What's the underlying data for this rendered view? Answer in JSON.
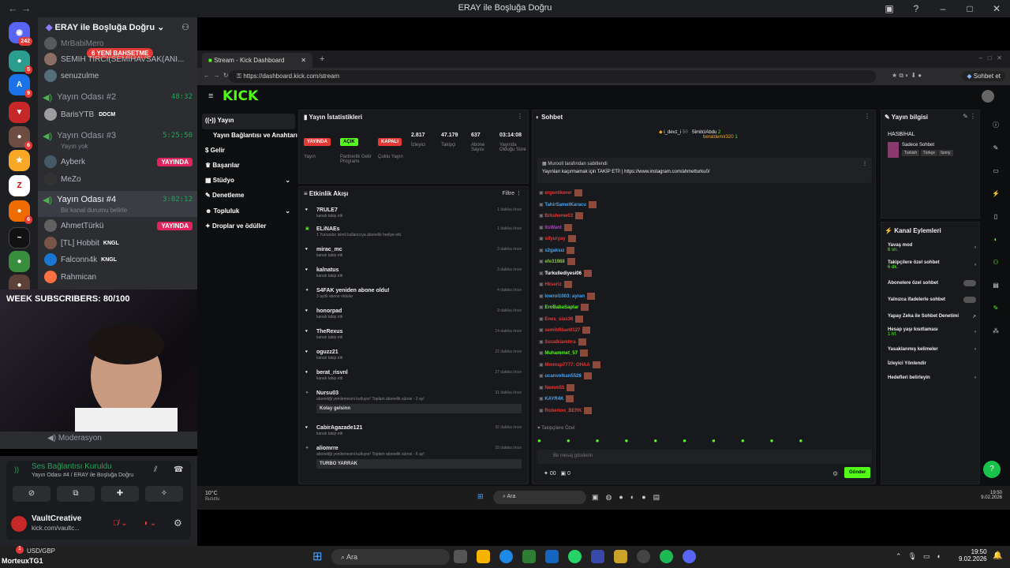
{
  "discord": {
    "window_title": "ERAY ile Boşluğa Doğru",
    "server_name": "ERAY ile Boşluğa Doğru",
    "mention_pill": "6 YENİ BAHSETME",
    "mention_badge": "242",
    "top_users": [
      "MrBabiMero",
      "SEMİH TIRCI(SEMİHAVSAK(ANI...",
      "senuzulme"
    ],
    "channels": [
      {
        "name": "Yayın Odası #2",
        "time": "48:32",
        "users": [
          {
            "name": "BarisYTB",
            "tag": "DDCM"
          }
        ]
      },
      {
        "name": "Yayın Odası #3",
        "time": "5:25:50",
        "status": "Yayın yok",
        "users": [
          {
            "name": "Ayberk",
            "live": "YAYINDA"
          },
          {
            "name": "MeZo"
          }
        ]
      },
      {
        "name": "Yayın Odası #4",
        "time": "3:02:12",
        "status": "Bir kanal durumu belirle",
        "users": [
          {
            "name": "AhmetTürkü",
            "live": "YAYINDA"
          },
          {
            "name": "[TL] Hobbit",
            "tag": "KNGL"
          },
          {
            "name": "Falconn4k",
            "tag": "KNGL"
          },
          {
            "name": "Rahmican"
          }
        ]
      }
    ],
    "moderation": "Moderasyon",
    "voice_status": "Ses Bağlantısı Kuruldu",
    "voice_sub": "Yayın Odası #4 / ERAY ile Boşluğa Doğru",
    "user_name": "VaultCreative",
    "user_status": "kick.com/vaultc...",
    "rail_badges": [
      "5",
      "9",
      "6",
      "6"
    ]
  },
  "overlay": {
    "subs": "WEEK SUBSCRIBERS: 80/100"
  },
  "browser": {
    "tab": "Stream - Kick Dashboard",
    "url": "https://dashboard.kick.com/stream",
    "chat_btn": "Sohbet et"
  },
  "kick": {
    "logo": "KICK",
    "menu": [
      "Yayın",
      "Yayın Bağlantısı ve Anahtarı",
      "Gelir",
      "Başarılar",
      "Stüdyo",
      "Denetleme",
      "Topluluk",
      "Droplar ve ödüller"
    ],
    "stats_title": "Yayın İstatistikleri",
    "stats": [
      {
        "tag": "YAYINDA",
        "label": "Yayın",
        "color": "#e53935"
      },
      {
        "tag": "AÇIK",
        "label": "Partnerlik Gelir Programı",
        "color": "#53fc18"
      },
      {
        "tag": "KAPALI",
        "label": "Çoklu Yayın",
        "color": "#e53935"
      },
      {
        "value": "2.817",
        "label": "İzleyici"
      },
      {
        "value": "47.179",
        "label": "Takipçi"
      },
      {
        "value": "637",
        "label": "Abone Sayısı"
      },
      {
        "value": "03:14:08",
        "label": "Yayında Olduğu Süre"
      }
    ],
    "feed_title": "Etkinlik Akışı",
    "feed_filter": "Filtre",
    "feed": [
      {
        "user": "7RULE7",
        "desc": "kanalı takip etti",
        "time": "1 dakika önce"
      },
      {
        "user": "ELiNAEs",
        "desc": "1 Yunusdur isimli kullanıcıya abonelik hediye etti.",
        "time": "1 dakika önce"
      },
      {
        "user": "mirac_mc",
        "desc": "kanalı takip etti",
        "time": "3 dakika önce"
      },
      {
        "user": "kalnatus",
        "desc": "kanalı takip etti",
        "time": "3 dakika önce"
      },
      {
        "user": "S4FAK yeniden abone oldu!",
        "desc": "3 aylık abone oldular",
        "time": "4 dakika önce"
      },
      {
        "user": "honorpad",
        "desc": "kanalı takip etti",
        "time": "9 dakika önce"
      },
      {
        "user": "TheRexus",
        "desc": "kanalı takip etti",
        "time": "14 dakika önce"
      },
      {
        "user": "oguzz21",
        "desc": "kanalı takip etti",
        "time": "22 dakika önce"
      },
      {
        "user": "berat_risvnl",
        "desc": "kanalı takip etti",
        "time": "27 dakika önce"
      },
      {
        "user": "Nursu03",
        "desc": "aboneliği yenilemesini kutluyor! Toplam abonelik süresi - 2 ay!",
        "time": "31 dakika önce",
        "note": "Kolay gelsinn"
      },
      {
        "user": "CabirAgazade121",
        "desc": "kanalı takip etti",
        "time": "32 dakika önce"
      },
      {
        "user": "aliomrre",
        "desc": "aboneliği yenilemesini kutluyor! Toplam abonelik süresi - 6 ay!",
        "time": "33 dakika önce",
        "note": "TURBO YARRAK"
      }
    ],
    "chat_title": "Sohbet",
    "top_gifters": [
      {
        "name": "i_devz_i",
        "val": "50"
      },
      {
        "name": "SimitciAbdu",
        "val": "2"
      },
      {
        "name": "beratdemir320",
        "val": "1"
      }
    ],
    "pinned_by": "Murooll tarafından sabitlendi",
    "pinned_msg": "Yayınları kaçırmamak için TAKİP ETİ! | https://www.instagram.com/ahmetturku0/",
    "chat_users": [
      "ergenlikerer",
      "TahirSametKaracu",
      "Brksheme03",
      "ItsWant",
      "sifyuryay",
      "s2gaksız",
      "efe31988",
      "Turkullediyesi06",
      "Hkseriz",
      "lowrol1003: ayran",
      "EroBabaSaplar",
      "Enes_sias36",
      "semihfiban0127",
      "Sozalkiamtrra",
      "Muhammet_57",
      "Mmmsp7777: OHAA",
      "ucanvolkan5528",
      "Nemm55",
      "KAYR4K",
      "Robertoo_BERK"
    ],
    "chat_placeholder": "Bir mesaj gönderin",
    "followers_only": "Takipçilere Özel",
    "send": "Gönder",
    "points": "00",
    "viewers0": "0",
    "info_title": "Yayın bilgisi",
    "stream_title": "HASBİHAL",
    "category": "Sadece Sohbet",
    "info_tags": [
      "Turkish",
      "Türkçe",
      "funny"
    ],
    "actions_title": "Kanal Eylemleri",
    "actions": [
      {
        "label": "Yavaş mod",
        "sub": "6 sn."
      },
      {
        "label": "Takipçilere özel sohbet",
        "sub": "6 dk."
      },
      {
        "label": "Abonelere özel sohbet"
      },
      {
        "label": "Yalnızca ifadelerle sohbet"
      },
      {
        "label": "Yapay Zeka ile Sohbet Denetimi"
      },
      {
        "label": "Hesap yaşı kısıtlaması",
        "sub": "1 hf."
      },
      {
        "label": "Yasaklanmış kelimeler"
      },
      {
        "label": "İzleyici Yönlendir"
      },
      {
        "label": "Hedefleri belirleyin"
      }
    ]
  },
  "taskbar_inner": {
    "weather": "10°C",
    "weather_sub": "Bulutlu",
    "search": "Ara",
    "time": "19:50",
    "date": "9.02.2026"
  },
  "taskbar": {
    "ticker": "USD/GBP",
    "user": "MorteuxTG1",
    "search": "Ara",
    "time": "19:50",
    "date": "9.02.2026",
    "badge": "1"
  }
}
